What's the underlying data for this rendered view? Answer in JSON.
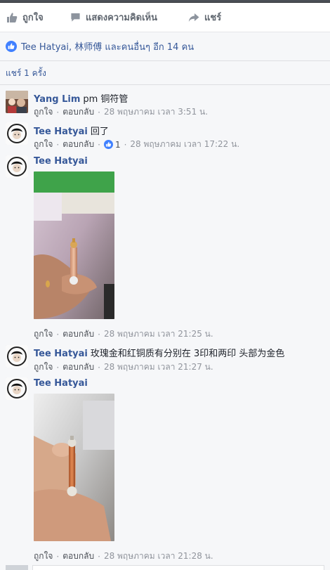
{
  "actions": {
    "like_label": "ถูกใจ",
    "comment_label": "แสดงความคิดเห็น",
    "share_label": "แชร์"
  },
  "likes_summary": "Tee Hatyai, 林师傅 และคนอื่นๆ อีก 14 คน",
  "shares_count": "แชร์ 1 ครั้ง",
  "comments": [
    {
      "author": "Yang Lim",
      "text": "pm 铜符管",
      "like": "ถูกใจ",
      "reply": "ตอบกลับ",
      "timestamp": "28 พฤษภาคม เวลา 3:51 น."
    },
    {
      "author": "Tee Hatyai",
      "text": "回了",
      "like": "ถูกใจ",
      "reply": "ตอบกลับ",
      "reactions": "1",
      "timestamp": "28 พฤษภาคม เวลา 17:22 น."
    },
    {
      "author": "Tee Hatyai",
      "text": "",
      "like": "ถูกใจ",
      "reply": "ตอบกลับ",
      "timestamp": "28 พฤษภาคม เวลา 21:25 น."
    },
    {
      "author": "Tee Hatyai",
      "text": "玫瑰金和红铜质有分别在 3印和两印 头部为金色",
      "like": "ถูกใจ",
      "reply": "ตอบกลับ",
      "timestamp": "28 พฤษภาคม เวลา 21:27 น."
    },
    {
      "author": "Tee Hatyai",
      "text": "",
      "like": "ถูกใจ",
      "reply": "ตอบกลับ",
      "timestamp": "28 พฤษภาคม เวลา 21:28 น."
    }
  ],
  "colors": {
    "link_blue": "#365899",
    "meta_gray": "#90949c",
    "like_blue": "#4080ff"
  },
  "icons": [
    "thumbs-up-icon",
    "comment-bubble-icon",
    "share-arrow-icon",
    "like-reaction-icon"
  ]
}
